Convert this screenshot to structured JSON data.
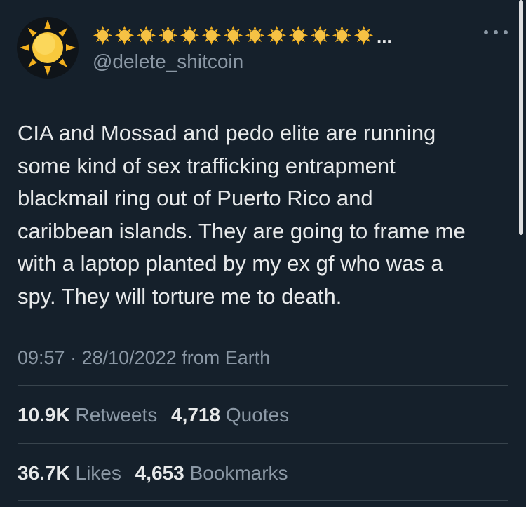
{
  "user": {
    "display_name_icon": "sun-emoji",
    "display_name_icon_count": 13,
    "display_name_ellipsis": "...",
    "handle": "@delete_shitcoin",
    "avatar_icon": "sun-emoji"
  },
  "more_icon": "more-dots-icon",
  "tweet": {
    "text": "CIA and Mossad and pedo elite are running\nsome kind of sex trafficking entrapment\nblackmail ring out of Puerto Rico and\ncaribbean islands. They are going to frame me\nwith a laptop planted by my ex gf who was a\nspy. They will torture me to death.",
    "time": "09:57",
    "separator": "·",
    "date": "28/10/2022",
    "source": "from Earth"
  },
  "stats": {
    "retweets_count": "10.9K",
    "retweets_label": "Retweets",
    "quotes_count": "4,718",
    "quotes_label": "Quotes",
    "likes_count": "36.7K",
    "likes_label": "Likes",
    "bookmarks_count": "4,653",
    "bookmarks_label": "Bookmarks"
  },
  "colors": {
    "background": "#15202b",
    "primary_text": "#e7e9ea",
    "secondary_text": "#8b98a5",
    "divider": "#38444d",
    "sun": "#f6c244"
  }
}
